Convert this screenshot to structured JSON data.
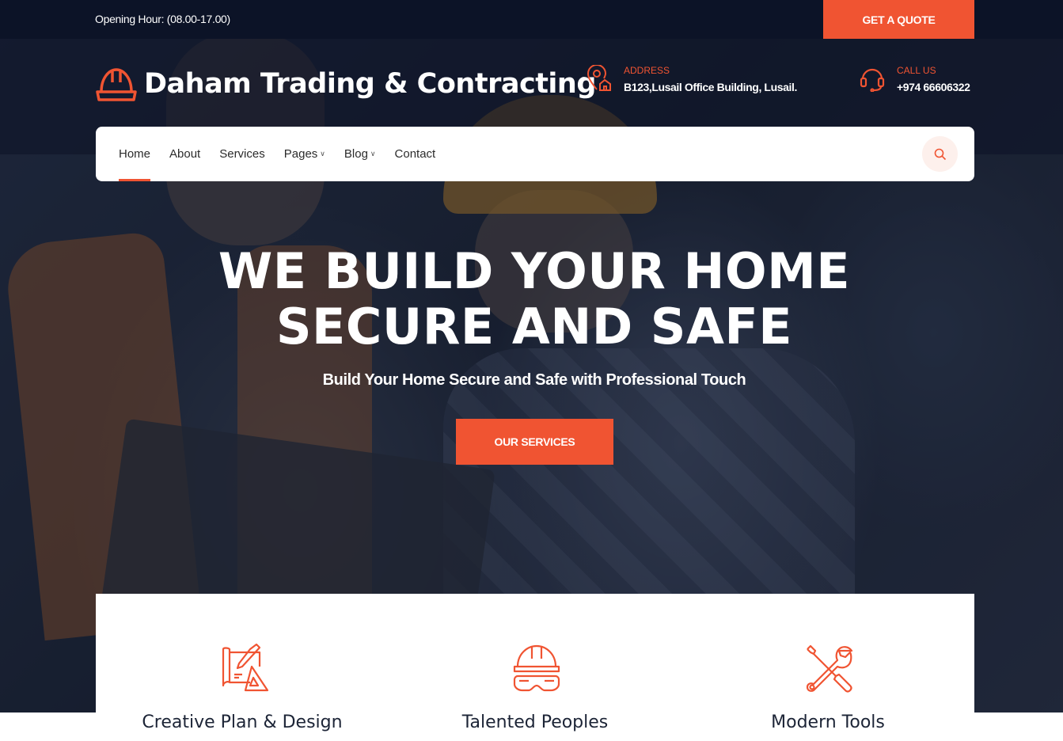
{
  "topbar": {
    "opening_hours": "Opening Hour: (08.00-17.00)",
    "quote_button": "GET A QUOTE"
  },
  "header": {
    "logo_text": "Daham Trading & Contracting",
    "address_label": "ADDRESS",
    "address_value": "B123,Lusail Office Building, Lusail.",
    "call_label": "CALL US",
    "call_value": "+974 66606322"
  },
  "nav": {
    "items": [
      {
        "label": "Home",
        "active": true,
        "dropdown": false
      },
      {
        "label": "About",
        "active": false,
        "dropdown": false
      },
      {
        "label": "Services",
        "active": false,
        "dropdown": false
      },
      {
        "label": "Pages",
        "active": false,
        "dropdown": true
      },
      {
        "label": "Blog",
        "active": false,
        "dropdown": true
      },
      {
        "label": "Contact",
        "active": false,
        "dropdown": false
      }
    ],
    "search_icon": "search-icon"
  },
  "hero": {
    "title_line1": "WE BUILD YOUR HOME",
    "title_line2": "SECURE AND SAFE",
    "subtitle": "Build Your Home Secure and Safe with Professional Touch",
    "cta": "OUR SERVICES"
  },
  "features": [
    {
      "title": "Creative Plan & Design",
      "icon": "blueprint-icon"
    },
    {
      "title": "Talented Peoples",
      "icon": "worker-helmet-icon"
    },
    {
      "title": "Modern Tools",
      "icon": "tools-icon"
    }
  ],
  "colors": {
    "accent": "#f05432",
    "dark": "#0c1327"
  }
}
